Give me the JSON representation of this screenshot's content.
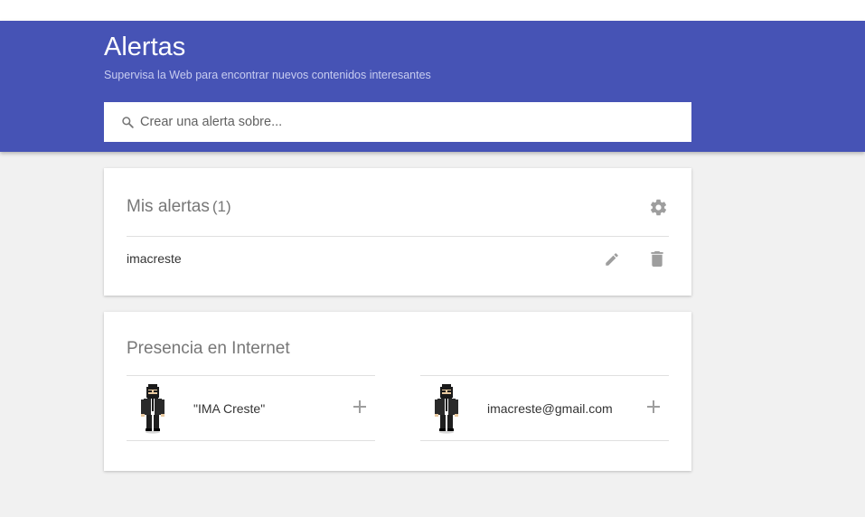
{
  "header": {
    "title": "Alertas",
    "subtitle": "Supervisa la Web para encontrar nuevos contenidos interesantes"
  },
  "search": {
    "placeholder": "Crear una alerta sobre...",
    "value": ""
  },
  "my_alerts": {
    "title": "Mis alertas",
    "count": "(1)",
    "items": [
      {
        "label": "imacreste"
      }
    ]
  },
  "presence": {
    "title": "Presencia en Internet",
    "items": [
      {
        "label": "\"IMA Creste\""
      },
      {
        "label": "imacreste@gmail.com"
      }
    ]
  },
  "colors": {
    "header_bg": "#4653b5",
    "page_bg": "#f1f1f1",
    "icon_gray": "#9e9e9e"
  },
  "icons": {
    "search": "search-icon",
    "settings": "gear-icon",
    "edit": "pencil-icon",
    "delete": "trash-icon",
    "add": "plus-icon",
    "avatar": "avatar"
  }
}
